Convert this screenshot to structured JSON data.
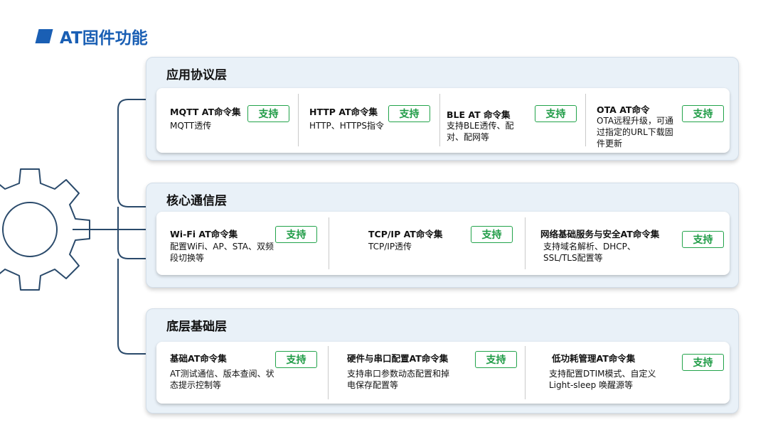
{
  "page": {
    "title": "AT固件功能"
  },
  "colors": {
    "accent": "#1a5fb4",
    "support": "#1e9b45",
    "layer_bg": "#e9f1f8"
  },
  "layers": [
    {
      "title": "应用协议层",
      "items": [
        {
          "name": "MQTT AT命令集",
          "desc": "MQTT透传",
          "badge": "支持"
        },
        {
          "name": "HTTP AT命令集",
          "desc": "HTTP、HTTPS指令",
          "badge": "支持"
        },
        {
          "name": "BLE AT 命令集",
          "desc": "支持BLE透传、配对、配网等",
          "badge": "支持"
        },
        {
          "name": "OTA AT命令",
          "desc": "OTA远程升级，可通过指定的URL下载固件更新",
          "badge": "支持"
        }
      ]
    },
    {
      "title": "核心通信层",
      "items": [
        {
          "name": "Wi-Fi AT命令集",
          "desc": "配置WiFi、AP、STA、双频段切换等",
          "badge": "支持"
        },
        {
          "name": "TCP/IP AT命令集",
          "desc": "TCP/IP透传",
          "badge": "支持"
        },
        {
          "name": "网络基础服务与安全AT命令集",
          "desc": "支持域名解析、DHCP、SSL/TLS配置等",
          "badge": "支持"
        }
      ]
    },
    {
      "title": "底层基础层",
      "items": [
        {
          "name": "基础AT命令集",
          "desc": "AT测试通信、版本查阅、状态提示控制等",
          "badge": "支持"
        },
        {
          "name": "硬件与串口配置AT命令集",
          "desc": "支持串口参数动态配置和掉电保存配置等",
          "badge": "支持"
        },
        {
          "name": "低功耗管理AT命令集",
          "desc": "支持配置DTIM模式、自定义Light-sleep 唤醒源等",
          "badge": "支持"
        }
      ]
    }
  ]
}
